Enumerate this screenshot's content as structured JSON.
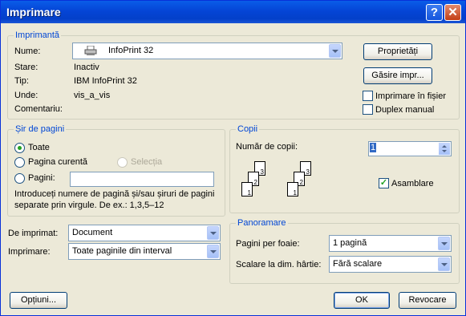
{
  "window": {
    "title": "Imprimare",
    "help_label": "?",
    "close_label": "✕"
  },
  "printer": {
    "legend": "Imprimantă",
    "name_label": "Nume:",
    "name_value": "InfoPrint 32",
    "state_label": "Stare:",
    "state_value": "Inactiv",
    "type_label": "Tip:",
    "type_value": "IBM InfoPrint 32",
    "where_label": "Unde:",
    "where_value": "vis_a_vis",
    "comment_label": "Comentariu:",
    "properties_button": "Proprietăți",
    "find_button": "Găsire impr...",
    "print_to_file_label": "Imprimare în fișier",
    "print_to_file_checked": false,
    "duplex_label": "Duplex manual",
    "duplex_checked": false
  },
  "pages": {
    "legend": "Șir de pagini",
    "all_label": "Toate",
    "current_label": "Pagina curentă",
    "selection_label": "Selecția",
    "pages_label": "Pagini:",
    "pages_value": "",
    "selected": "all",
    "help_line1": "Introduceți numere de pagină și/sau șiruri de pagini",
    "help_line2": "separate prin virgule.  De ex.: 1,3,5–12"
  },
  "copies": {
    "legend": "Copii",
    "count_label": "Număr de copii:",
    "count_value": "1",
    "collate_label": "Asamblare",
    "collate_checked": true,
    "page_numbers": [
      "3",
      "2",
      "1"
    ]
  },
  "print_what": {
    "label": "De imprimat:",
    "value": "Document"
  },
  "print_range": {
    "label": "Imprimare:",
    "value": "Toate paginile din interval"
  },
  "zoom": {
    "legend": "Panoramare",
    "pages_per_sheet_label": "Pagini per foaie:",
    "pages_per_sheet_value": "1 pagină",
    "scale_label": "Scalare la dim. hârtie:",
    "scale_value": "Fără scalare"
  },
  "footer": {
    "options_button": "Opțiuni...",
    "ok_button": "OK",
    "cancel_button": "Revocare"
  },
  "icons": {
    "printer": "printer-icon",
    "spinner": "spin-arrows-icon"
  }
}
